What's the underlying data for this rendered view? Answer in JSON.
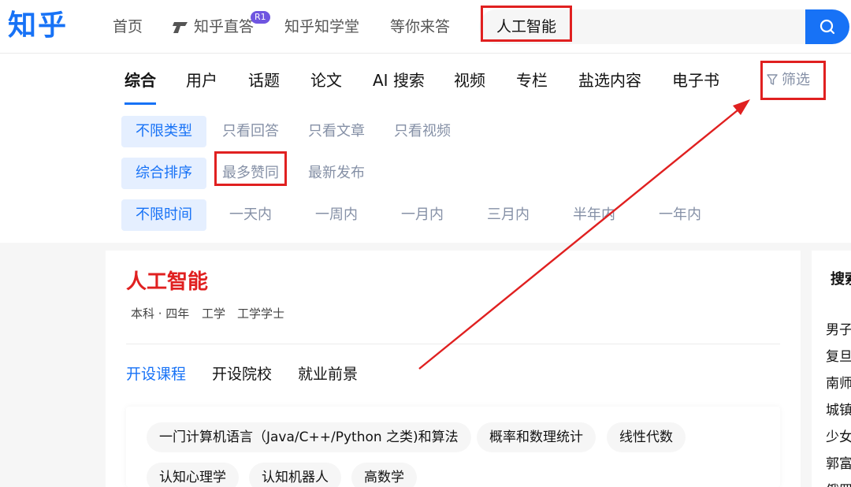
{
  "header": {
    "logo": "知乎",
    "nav": [
      "首页",
      "知乎直答",
      "知乎知学堂",
      "等你来答"
    ],
    "nav_badge": "R1",
    "search_value": "人工智能"
  },
  "tabs": [
    "综合",
    "用户",
    "话题",
    "论文",
    "AI 搜索",
    "视频",
    "专栏",
    "盐选内容",
    "电子书"
  ],
  "filter_label": "筛选",
  "filters": {
    "type": [
      "不限类型",
      "只看回答",
      "只看文章",
      "只看视频"
    ],
    "sort": [
      "综合排序",
      "最多赞同",
      "最新发布"
    ],
    "time": [
      "不限时间",
      "一天内",
      "一周内",
      "一月内",
      "三月内",
      "半年内",
      "一年内"
    ]
  },
  "major": {
    "title": "人工智能",
    "meta": [
      "本科 · 四年",
      "工学",
      "工学学士"
    ],
    "subtabs": [
      "开设课程",
      "开设院校",
      "就业前景"
    ],
    "courses": [
      "一门计算机语言（Java/C++/Python 之类)和算法",
      "概率和数理统计",
      "线性代数",
      "认知心理学",
      "认知机器人",
      "高数学"
    ]
  },
  "side": {
    "title": "搜索",
    "items": [
      "男子",
      "复旦",
      "南师",
      "城镇",
      "少女",
      "郭富",
      "俄罗"
    ]
  },
  "colors": {
    "brand": "#1772f6",
    "highlight": "#e02020"
  }
}
